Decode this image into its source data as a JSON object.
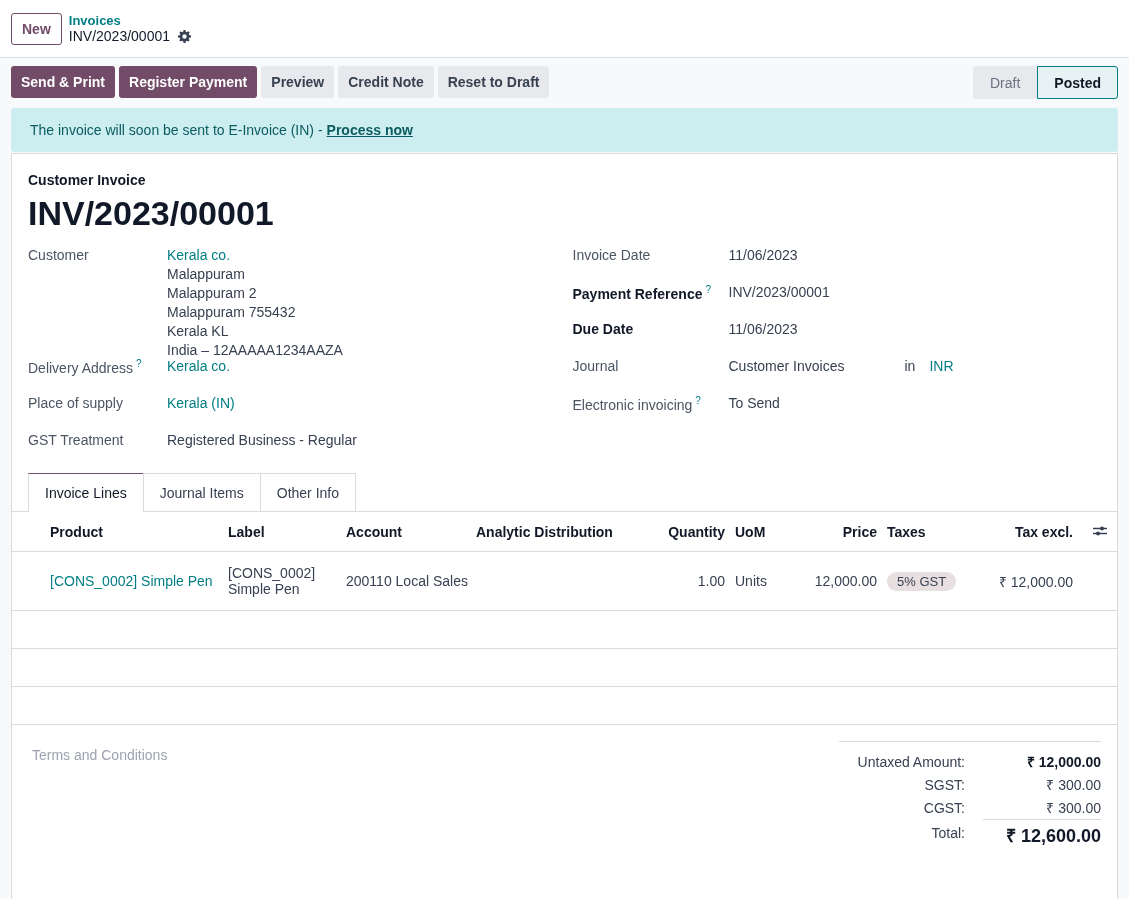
{
  "breadcrumb": {
    "new_button": "New",
    "parent": "Invoices",
    "current": "INV/2023/00001"
  },
  "action_buttons": [
    {
      "label": "Send & Print",
      "kind": "primary"
    },
    {
      "label": "Register Payment",
      "kind": "primary"
    },
    {
      "label": "Preview",
      "kind": "secondary"
    },
    {
      "label": "Credit Note",
      "kind": "secondary"
    },
    {
      "label": "Reset to Draft",
      "kind": "secondary"
    }
  ],
  "status_stages": [
    {
      "label": "Draft",
      "selected": false
    },
    {
      "label": "Posted",
      "selected": true
    }
  ],
  "alert": {
    "text": "The invoice will soon be sent to E-Invoice (IN) -",
    "link": "Process now"
  },
  "form": {
    "type_label": "Customer Invoice",
    "title": "INV/2023/00001",
    "left_fields": [
      {
        "label": "Customer",
        "bold": false,
        "kind": "address",
        "value": "Kerala co.",
        "lines": [
          "Malappuram",
          "Malappuram 2",
          "Malappuram 755432",
          "Kerala KL",
          "India – 12AAAAA1234AAZA"
        ]
      },
      {
        "label": "Delivery Address",
        "bold": false,
        "help": "?",
        "kind": "link",
        "value": "Kerala co."
      },
      {
        "label": "Place of supply",
        "bold": false,
        "kind": "link",
        "value": "Kerala (IN)"
      },
      {
        "label": "GST Treatment",
        "bold": false,
        "kind": "text",
        "value": "Registered Business - Regular"
      }
    ],
    "right_fields": [
      {
        "label": "Invoice Date",
        "bold": false,
        "kind": "text",
        "value": "11/06/2023"
      },
      {
        "label": "Payment Reference",
        "bold": true,
        "help": "?",
        "kind": "text",
        "value": "INV/2023/00001"
      },
      {
        "label": "Due Date",
        "bold": true,
        "kind": "text",
        "value": "11/06/2023"
      },
      {
        "label": "Journal",
        "bold": false,
        "kind": "journal",
        "value": "Customer Invoices",
        "joiner": "in",
        "currency": "INR"
      },
      {
        "label": "Electronic invoicing",
        "bold": false,
        "help": "?",
        "kind": "text",
        "value": "To Send"
      }
    ]
  },
  "tabs": [
    {
      "label": "Invoice Lines",
      "selected": true
    },
    {
      "label": "Journal Items",
      "selected": false
    },
    {
      "label": "Other Info",
      "selected": false
    }
  ],
  "table": {
    "columns": [
      "Product",
      "Label",
      "Account",
      "Analytic Distribution",
      "Quantity",
      "UoM",
      "Price",
      "Taxes",
      "Tax excl."
    ],
    "rows": [
      {
        "product": "[CONS_0002] Simple Pen",
        "label": "[CONS_0002] Simple Pen",
        "account": "200110 Local Sales",
        "quantity": "1.00",
        "uom": "Units",
        "price": "12,000.00",
        "taxes": [
          "5% GST"
        ],
        "subtotal": "₹ 12,000.00"
      }
    ]
  },
  "terms": {
    "placeholder": "Terms and Conditions"
  },
  "totals": [
    {
      "label": "Untaxed Amount:",
      "value": "₹ 12,000.00",
      "kind": "bold"
    },
    {
      "label": "SGST:",
      "value": "₹ 300.00",
      "kind": "normal"
    },
    {
      "label": "CGST:",
      "value": "₹ 300.00",
      "kind": "normal"
    },
    {
      "label": "Total:",
      "value": "₹ 12,600.00",
      "kind": "grand"
    }
  ]
}
